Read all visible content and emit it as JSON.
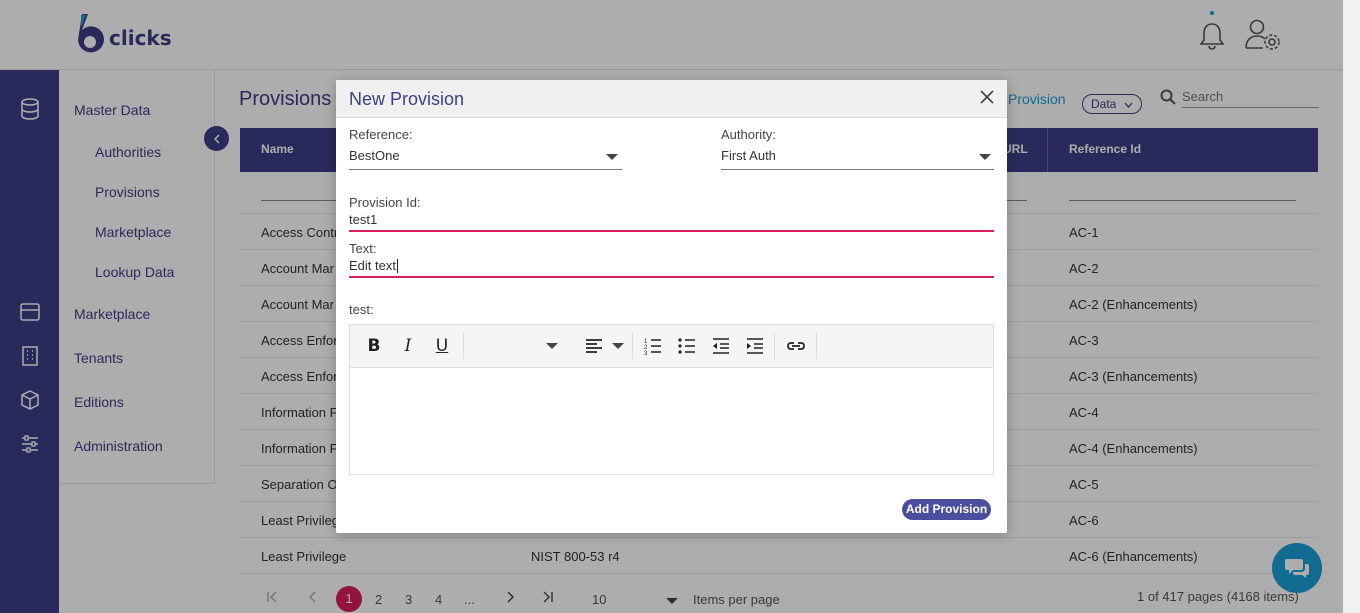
{
  "app": {
    "logo_text": "clicks",
    "logo_number": "6"
  },
  "header": {
    "notification_icon": "bell-icon",
    "account_icon": "user-settings-icon"
  },
  "rail": {
    "icons": [
      "database-icon",
      "store-icon",
      "building-icon",
      "box-icon",
      "sliders-icon"
    ]
  },
  "sidebar": {
    "master_data": "Master Data",
    "authorities": "Authorities",
    "provisions": "Provisions",
    "marketplace_sub": "Marketplace",
    "lookup_data": "Lookup Data",
    "marketplace": "Marketplace",
    "tenants": "Tenants",
    "editions": "Editions",
    "administration": "Administration"
  },
  "main": {
    "title": "Provisions",
    "add_link": "Provision",
    "data_dropdown": "Data",
    "search_placeholder": "Search",
    "columns": {
      "name": "Name",
      "url": "URL",
      "reference_id": "Reference Id"
    },
    "rows": [
      {
        "name": "Access Contr",
        "authority": "",
        "ref": "AC-1"
      },
      {
        "name": "Account Mar",
        "authority": "",
        "ref": "AC-2"
      },
      {
        "name": "Account Mar",
        "authority": "",
        "ref": "AC-2 (Enhancements)"
      },
      {
        "name": "Access Enfor",
        "authority": "",
        "ref": "AC-3"
      },
      {
        "name": "Access Enfor",
        "authority": "",
        "ref": "AC-3 (Enhancements)"
      },
      {
        "name": "Information F",
        "authority": "",
        "ref": "AC-4"
      },
      {
        "name": "Information F",
        "authority": "",
        "ref": "AC-4  (Enhancements)"
      },
      {
        "name": "Separation O",
        "authority": "",
        "ref": "AC-5"
      },
      {
        "name": "Least Privileg",
        "authority": "",
        "ref": "AC-6"
      },
      {
        "name": "Least Privilege",
        "authority": "NIST 800-53 r4",
        "ref": "AC-6  (Enhancements)"
      }
    ],
    "pager": {
      "pages": [
        "1",
        "2",
        "3",
        "4",
        "..."
      ],
      "page_size": "10",
      "items_per_page": "Items per page",
      "summary": "1 of 417 pages (4168 items)"
    }
  },
  "modal": {
    "title": "New Provision",
    "reference_label": "Reference:",
    "reference_value": "BestOne",
    "authority_label": "Authority:",
    "authority_value": "First Auth",
    "provision_id_label": "Provision Id:",
    "provision_id_value": "test1",
    "text_label": "Text:",
    "text_value": "Edit text",
    "custom_label": "test:",
    "toolbar": [
      "bold",
      "italic",
      "underline",
      "font-size",
      "align",
      "ordered-list",
      "bullet-list",
      "outdent",
      "indent",
      "link"
    ],
    "submit": "Add Provision"
  },
  "colors": {
    "primary": "#3d3f87",
    "accent": "#d81e5b",
    "link": "#1a9fd6"
  }
}
